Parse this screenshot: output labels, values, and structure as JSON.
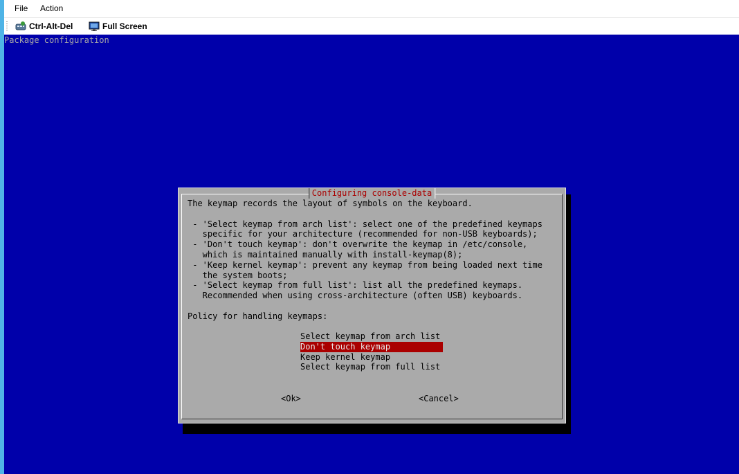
{
  "menubar": {
    "file": "File",
    "action": "Action"
  },
  "toolbar": {
    "ctrl_alt_del": "Ctrl-Alt-Del",
    "full_screen": "Full Screen"
  },
  "console": {
    "backtitle": "Package configuration",
    "dialog": {
      "title": "Configuring console-data",
      "body": "The keymap records the layout of symbols on the keyboard.\n\n - 'Select keymap from arch list': select one of the predefined keymaps\n   specific for your architecture (recommended for non-USB keyboards);\n - 'Don't touch keymap': don't overwrite the keymap in /etc/console,\n   which is maintained manually with install-keymap(8);\n - 'Keep kernel keymap': prevent any keymap from being loaded next time\n   the system boots;\n - 'Select keymap from full list': list all the predefined keymaps.\n   Recommended when using cross-architecture (often USB) keyboards.\n\nPolicy for handling keymaps:",
      "options": [
        "Select keymap from arch list",
        "Don't touch keymap",
        "Keep kernel keymap",
        "Select keymap from full list"
      ],
      "selected_option": "Don't touch keymap",
      "ok": "<Ok>",
      "cancel": "<Cancel>"
    },
    "colors": {
      "background": "#0000aa",
      "dialog": "#aaaaaa",
      "title": "#aa0000",
      "selection": "#aa0000"
    }
  }
}
